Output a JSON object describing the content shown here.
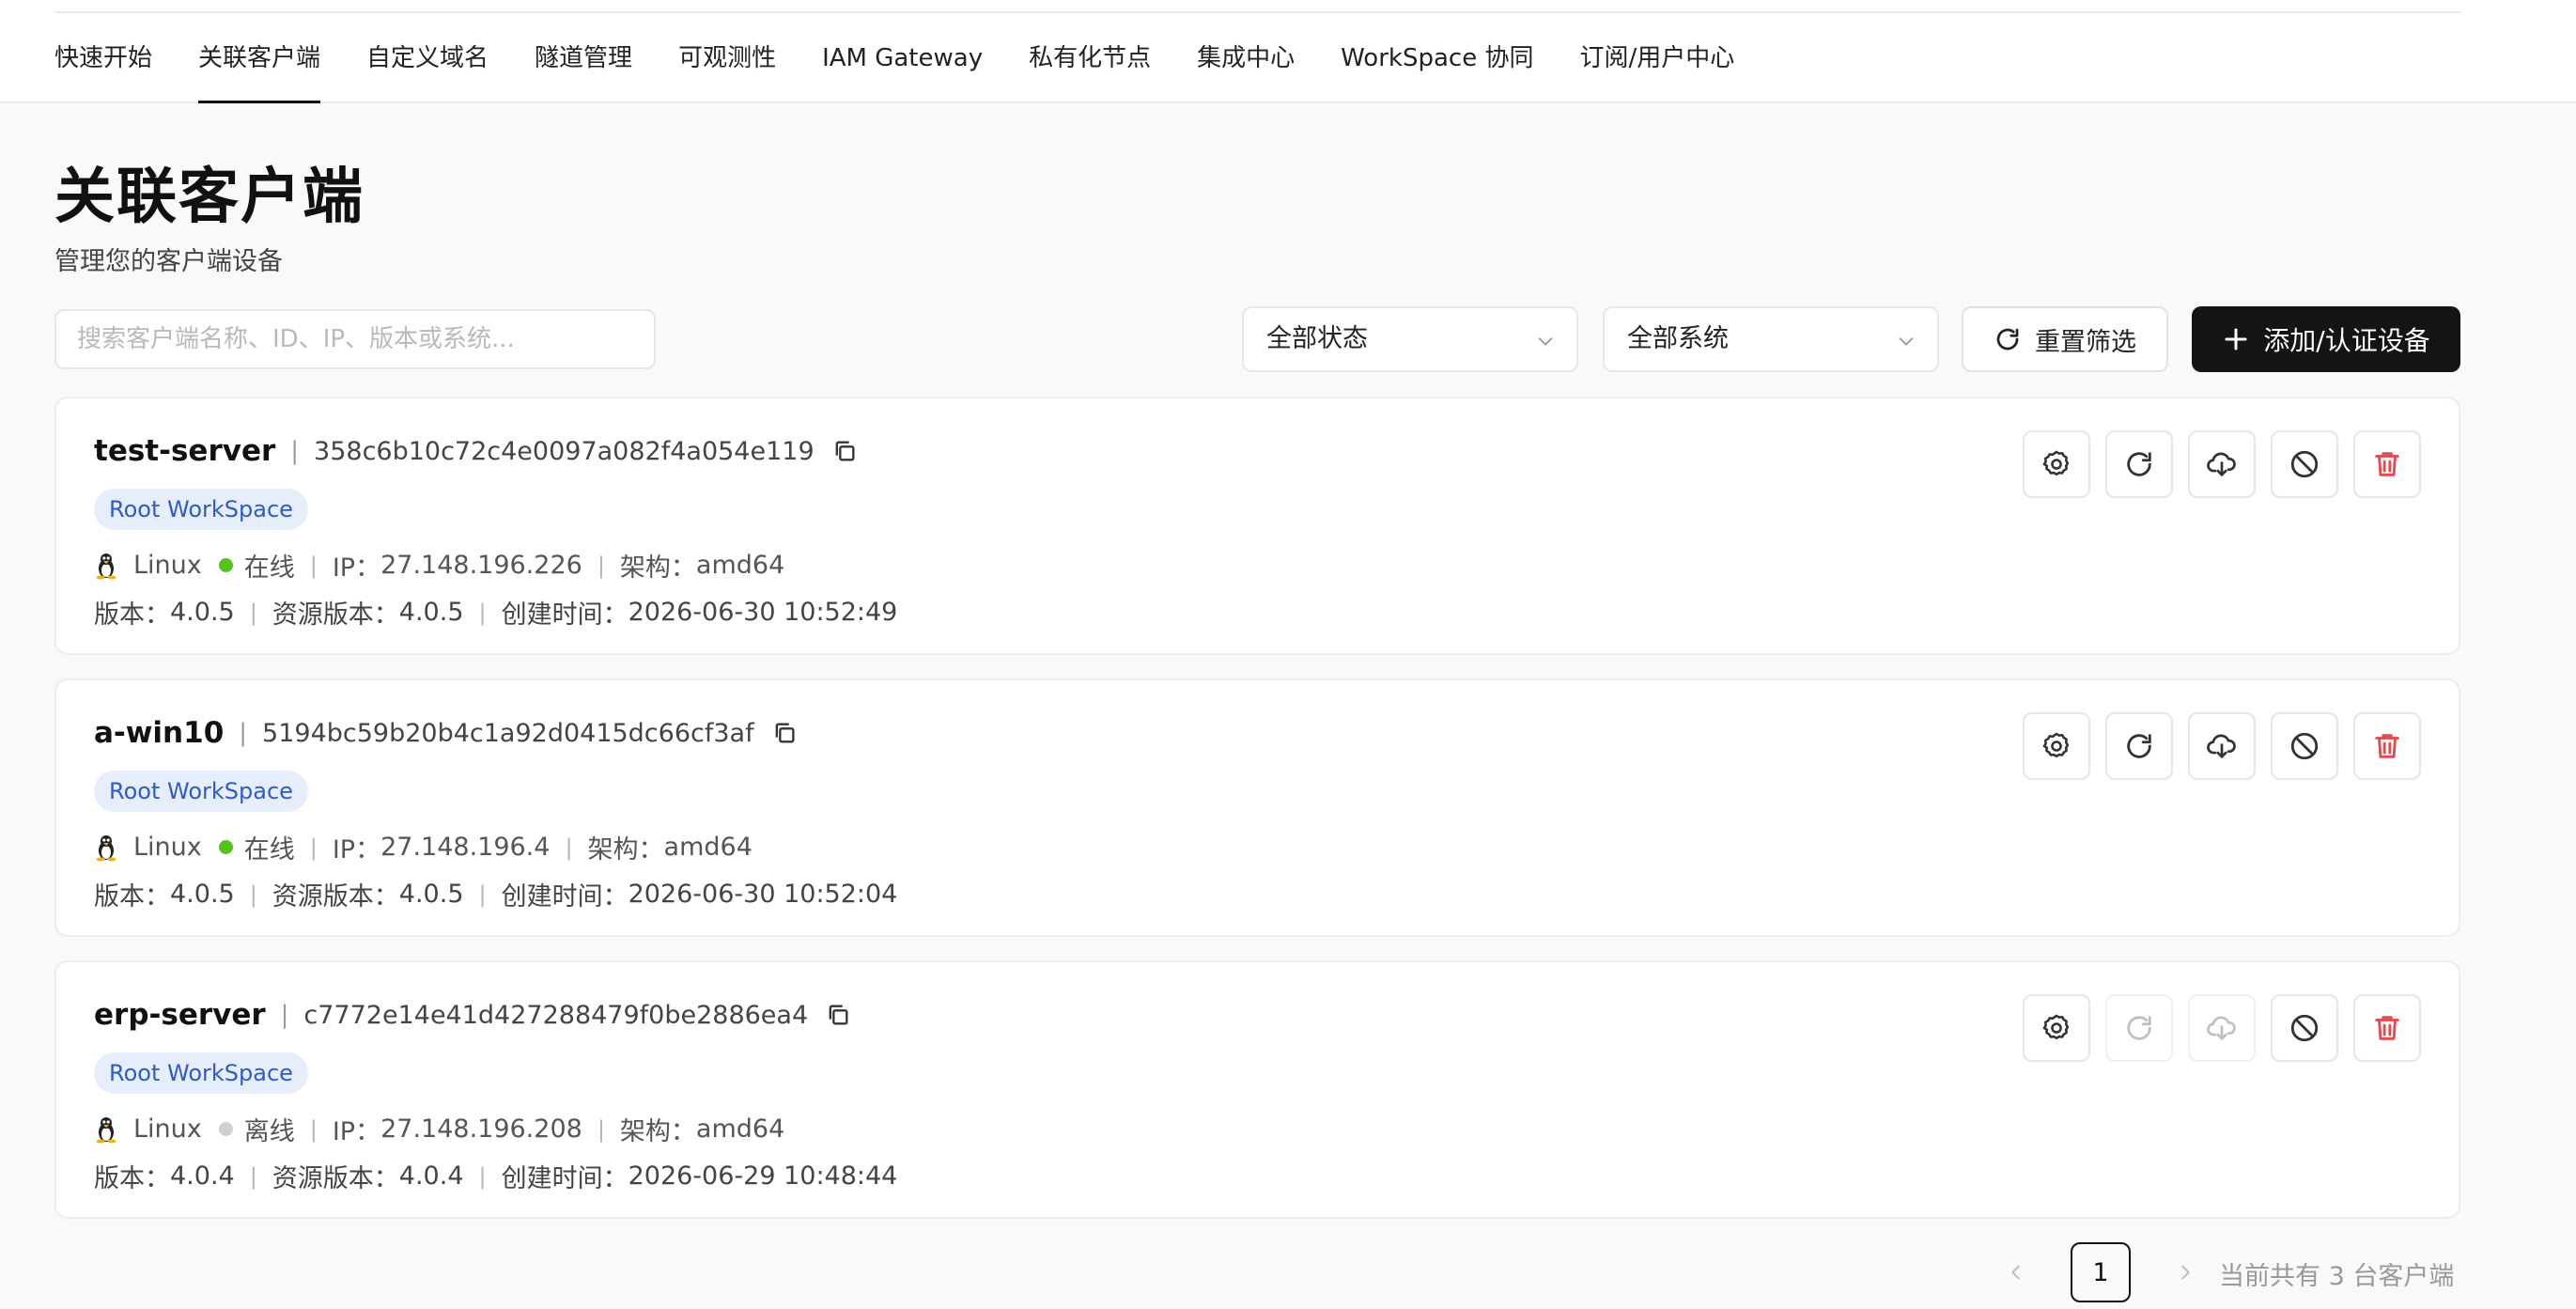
{
  "nav": {
    "items": [
      {
        "label": "快速开始"
      },
      {
        "label": "关联客户端",
        "active": true
      },
      {
        "label": "自定义域名"
      },
      {
        "label": "隧道管理"
      },
      {
        "label": "可观测性"
      },
      {
        "label": "IAM Gateway"
      },
      {
        "label": "私有化节点"
      },
      {
        "label": "集成中心"
      },
      {
        "label": "WorkSpace 协同"
      },
      {
        "label": "订阅/用户中心"
      }
    ]
  },
  "header": {
    "title": "关联客户端",
    "subtitle": "管理您的客户端设备"
  },
  "filters": {
    "search_placeholder": "搜索客户端名称、ID、IP、版本或系统...",
    "status_select": "全部状态",
    "system_select": "全部系统",
    "reset_label": "重置筛选",
    "add_label": "添加/认证设备"
  },
  "clients": [
    {
      "name": "test-server",
      "id": "358c6b10c72c4e0097a082f4a054e119",
      "tag": "Root WorkSpace",
      "os": "Linux",
      "status": "在线",
      "online": true,
      "ip_label": "IP：",
      "ip": "27.148.196.226",
      "arch_label": "架构：",
      "arch": "amd64",
      "version_label": "版本：",
      "version": "4.0.5",
      "res_version_label": "资源版本：",
      "res_version": "4.0.5",
      "created_label": "创建时间：",
      "created": "2026-06-30 10:52:49"
    },
    {
      "name": "a-win10",
      "id": "5194bc59b20b4c1a92d0415dc66cf3af",
      "tag": "Root WorkSpace",
      "os": "Linux",
      "status": "在线",
      "online": true,
      "ip_label": "IP：",
      "ip": "27.148.196.4",
      "arch_label": "架构：",
      "arch": "amd64",
      "version_label": "版本：",
      "version": "4.0.5",
      "res_version_label": "资源版本：",
      "res_version": "4.0.5",
      "created_label": "创建时间：",
      "created": "2026-06-30 10:52:04"
    },
    {
      "name": "erp-server",
      "id": "c7772e14e41d427288479f0be2886ea4",
      "tag": "Root WorkSpace",
      "os": "Linux",
      "status": "离线",
      "online": false,
      "ip_label": "IP：",
      "ip": "27.148.196.208",
      "arch_label": "架构：",
      "arch": "amd64",
      "version_label": "版本：",
      "version": "4.0.4",
      "res_version_label": "资源版本：",
      "res_version": "4.0.4",
      "created_label": "创建时间：",
      "created": "2026-06-29 10:48:44"
    }
  ],
  "pagination": {
    "current_page": "1",
    "total_text": "当前共有 3 台客户端"
  },
  "colors": {
    "online": "#52c41a",
    "offline": "#cfcfcf",
    "danger": "#e5484d",
    "primary_button": "#141414",
    "tag_bg": "#e6eefc",
    "tag_text": "#2f5bc4"
  }
}
